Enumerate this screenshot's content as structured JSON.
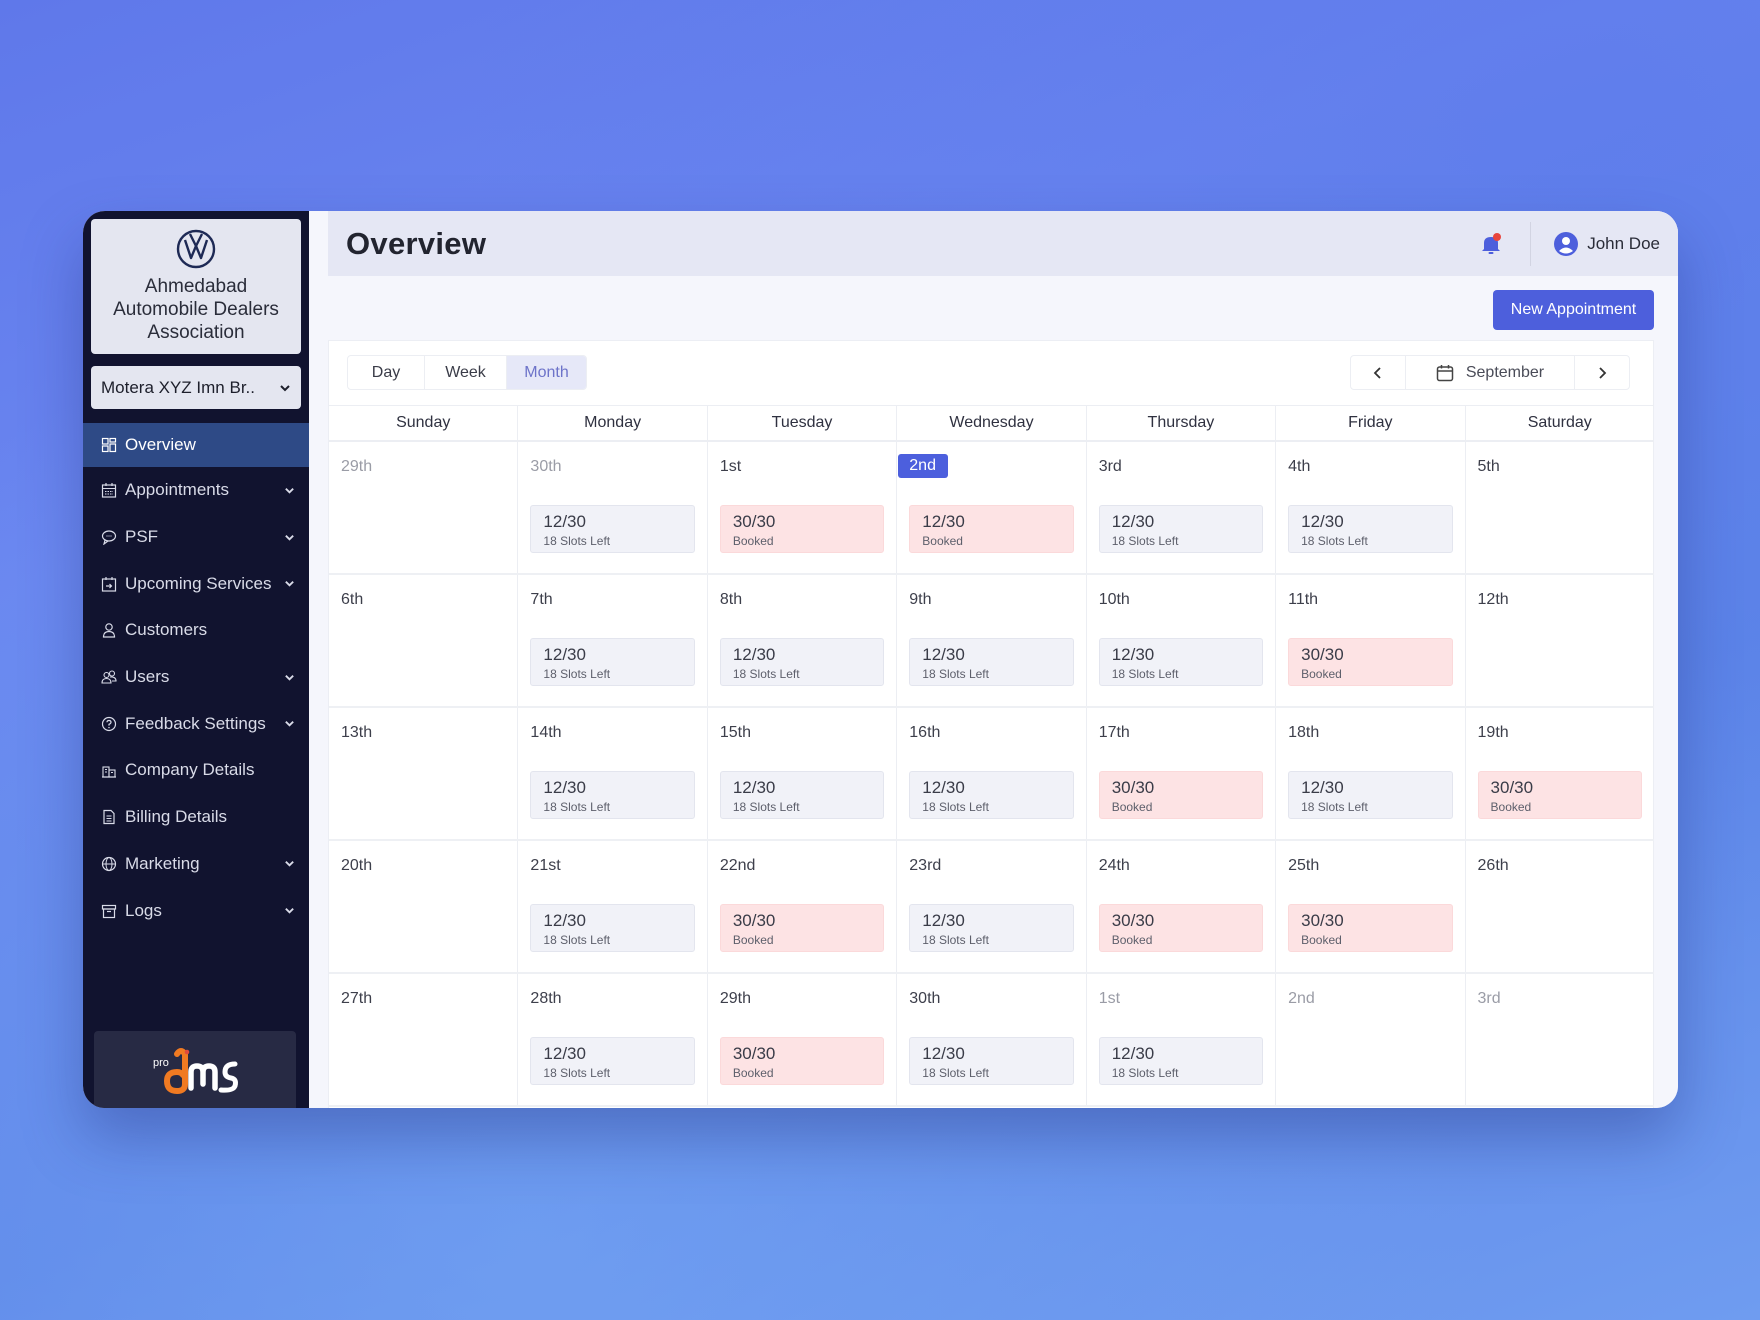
{
  "sidebar": {
    "org_name": "Ahmedabad Automobile Dealers Association",
    "branch_selected": "Motera XYZ Imn Br..",
    "items": [
      {
        "label": "Overview",
        "icon": "dashboard-icon",
        "active": true,
        "expandable": false
      },
      {
        "label": "Appointments",
        "icon": "calendar-icon",
        "active": false,
        "expandable": true
      },
      {
        "label": "PSF",
        "icon": "chat-bubble-icon",
        "active": false,
        "expandable": true
      },
      {
        "label": "Upcoming Services",
        "icon": "calendar-arrow-icon",
        "active": false,
        "expandable": true
      },
      {
        "label": "Customers",
        "icon": "user-icon",
        "active": false,
        "expandable": false
      },
      {
        "label": "Users",
        "icon": "users-icon",
        "active": false,
        "expandable": true
      },
      {
        "label": "Feedback Settings",
        "icon": "help-circle-icon",
        "active": false,
        "expandable": true
      },
      {
        "label": "Company Details",
        "icon": "building-icon",
        "active": false,
        "expandable": false
      },
      {
        "label": "Billing Details",
        "icon": "document-icon",
        "active": false,
        "expandable": false
      },
      {
        "label": "Marketing",
        "icon": "globe-icon",
        "active": false,
        "expandable": true
      },
      {
        "label": "Logs",
        "icon": "archive-icon",
        "active": false,
        "expandable": true
      }
    ],
    "footer_logo": {
      "prefix": "pro",
      "name": "dms"
    }
  },
  "header": {
    "title": "Overview",
    "user_name": "John Doe",
    "has_notification": true
  },
  "actions": {
    "new_appointment": "New Appointment"
  },
  "view_tabs": [
    {
      "label": "Day",
      "active": false
    },
    {
      "label": "Week",
      "active": false
    },
    {
      "label": "Month",
      "active": true
    }
  ],
  "month_nav": {
    "label": "September",
    "prev": "<",
    "next": ">"
  },
  "colors": {
    "accent": "#4d5fdc",
    "sidebar": "#11132f",
    "booked": "#fde3e4",
    "available": "#f1f2f8"
  },
  "weekdays": [
    "Sunday",
    "Monday",
    "Tuesday",
    "Wednesday",
    "Thursday",
    "Friday",
    "Saturday"
  ],
  "weeks": [
    [
      {
        "day": "29th",
        "muted": true
      },
      {
        "day": "30th",
        "muted": true,
        "slot": {
          "count": "12/30",
          "status": "18 Slots Left",
          "type": "available"
        }
      },
      {
        "day": "1st",
        "slot": {
          "count": "30/30",
          "status": "Booked",
          "type": "booked"
        }
      },
      {
        "day": "2nd",
        "today": true,
        "slot": {
          "count": "12/30",
          "status": "Booked",
          "type": "booked"
        }
      },
      {
        "day": "3rd",
        "slot": {
          "count": "12/30",
          "status": "18 Slots Left",
          "type": "available"
        }
      },
      {
        "day": "4th",
        "slot": {
          "count": "12/30",
          "status": "18 Slots Left",
          "type": "available"
        }
      },
      {
        "day": "5th"
      }
    ],
    [
      {
        "day": "6th"
      },
      {
        "day": "7th",
        "slot": {
          "count": "12/30",
          "status": "18 Slots Left",
          "type": "available"
        }
      },
      {
        "day": "8th",
        "slot": {
          "count": "12/30",
          "status": "18 Slots Left",
          "type": "available"
        }
      },
      {
        "day": "9th",
        "slot": {
          "count": "12/30",
          "status": "18 Slots Left",
          "type": "available"
        }
      },
      {
        "day": "10th",
        "slot": {
          "count": "12/30",
          "status": "18 Slots Left",
          "type": "available"
        }
      },
      {
        "day": "11th",
        "slot": {
          "count": "30/30",
          "status": "Booked",
          "type": "booked"
        }
      },
      {
        "day": "12th"
      }
    ],
    [
      {
        "day": "13th"
      },
      {
        "day": "14th",
        "slot": {
          "count": "12/30",
          "status": "18 Slots Left",
          "type": "available"
        }
      },
      {
        "day": "15th",
        "slot": {
          "count": "12/30",
          "status": "18 Slots Left",
          "type": "available"
        }
      },
      {
        "day": "16th",
        "slot": {
          "count": "12/30",
          "status": "18 Slots Left",
          "type": "available"
        }
      },
      {
        "day": "17th",
        "slot": {
          "count": "30/30",
          "status": "Booked",
          "type": "booked"
        }
      },
      {
        "day": "18th",
        "slot": {
          "count": "12/30",
          "status": "18 Slots Left",
          "type": "available"
        }
      },
      {
        "day": "19th",
        "slot": {
          "count": "30/30",
          "status": "Booked",
          "type": "booked"
        }
      }
    ],
    [
      {
        "day": "20th"
      },
      {
        "day": "21st",
        "slot": {
          "count": "12/30",
          "status": "18 Slots Left",
          "type": "available"
        }
      },
      {
        "day": "22nd",
        "slot": {
          "count": "30/30",
          "status": "Booked",
          "type": "booked"
        }
      },
      {
        "day": "23rd",
        "slot": {
          "count": "12/30",
          "status": "18 Slots Left",
          "type": "available"
        }
      },
      {
        "day": "24th",
        "slot": {
          "count": "30/30",
          "status": "Booked",
          "type": "booked"
        }
      },
      {
        "day": "25th",
        "slot": {
          "count": "30/30",
          "status": "Booked",
          "type": "booked"
        }
      },
      {
        "day": "26th"
      }
    ],
    [
      {
        "day": "27th"
      },
      {
        "day": "28th",
        "slot": {
          "count": "12/30",
          "status": "18 Slots Left",
          "type": "available"
        }
      },
      {
        "day": "29th",
        "slot": {
          "count": "30/30",
          "status": "Booked",
          "type": "booked"
        }
      },
      {
        "day": "30th",
        "slot": {
          "count": "12/30",
          "status": "18 Slots Left",
          "type": "available"
        }
      },
      {
        "day": "1st",
        "muted": true,
        "slot": {
          "count": "12/30",
          "status": "18 Slots Left",
          "type": "available"
        }
      },
      {
        "day": "2nd",
        "muted": true
      },
      {
        "day": "3rd",
        "muted": true
      }
    ]
  ]
}
